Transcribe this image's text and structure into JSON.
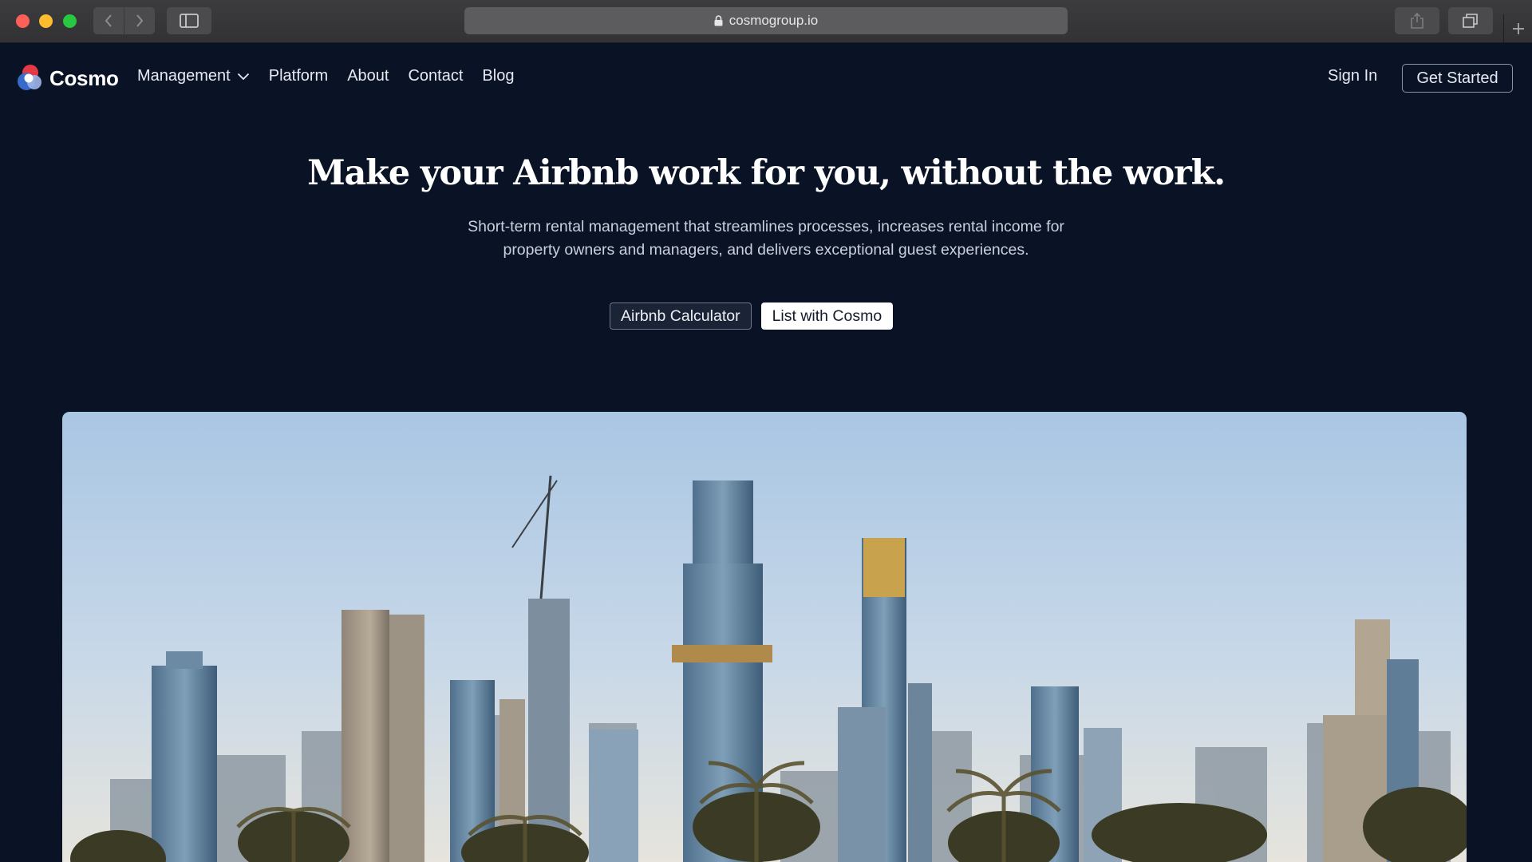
{
  "browser": {
    "url": "cosmogroup.io"
  },
  "nav": {
    "logo_text": "Cosmo",
    "menu": [
      "Management",
      "Platform",
      "About",
      "Contact",
      "Blog"
    ],
    "sign_in": "Sign In",
    "get_started": "Get Started"
  },
  "hero": {
    "title": "Make your Airbnb work for you, without the work.",
    "subtitle_line1": "Short-term rental management that streamlines processes, increases rental income for",
    "subtitle_line2": "property owners and managers, and delivers exceptional guest experiences.",
    "btn_calculator": "Airbnb Calculator",
    "btn_list": "List with Cosmo"
  },
  "colors": {
    "background": "#0a1326",
    "logo_red": "#e63946",
    "logo_blue": "#3b6fd4"
  },
  "icons": [
    "lock-icon",
    "chevron-left-icon",
    "chevron-right-icon",
    "sidebar-icon",
    "share-icon",
    "tabs-icon",
    "plus-icon",
    "chevron-down-icon",
    "cosmo-logo-icon"
  ]
}
